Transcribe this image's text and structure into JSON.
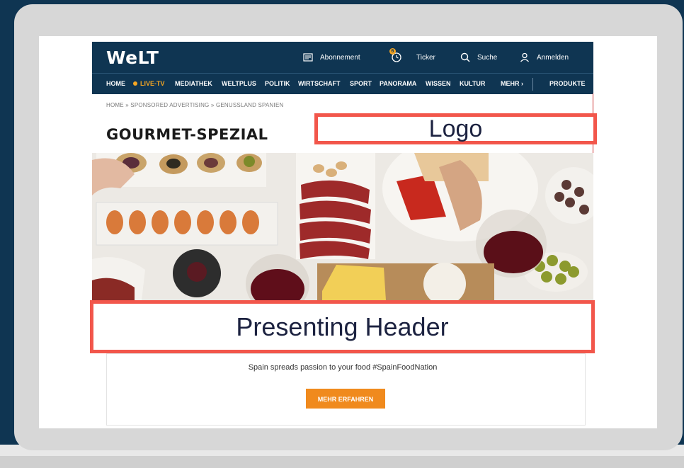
{
  "site": {
    "logo": "WeLT",
    "utility": {
      "abonnement": "Abonnement",
      "ticker": "Ticker",
      "ticker_badge": "6",
      "suche": "Suche",
      "anmelden": "Anmelden"
    },
    "nav": [
      "HOME",
      "LIVE-TV",
      "MEDIATHEK",
      "WELTPLUS",
      "POLITIK",
      "WIRTSCHAFT",
      "SPORT",
      "PANORAMA",
      "WISSEN",
      "KULTUR",
      "MEHR",
      "PRODUKTE"
    ],
    "breadcrumb": "HOME » SPONSORED ADVERTISING » GENUSSLAND SPANIEN",
    "page_title": "GOURMET-SPEZIAL",
    "tagline": "Spain spreads passion to your food #SpainFoodNation",
    "cta": "MEHR ERFAHREN"
  },
  "annotations": {
    "logo": "Logo",
    "header": "Presenting Header"
  },
  "colors": {
    "brand_navy": "#0f3552",
    "accent_orange": "#f08a1d",
    "live_orange": "#f5a623",
    "annotation_red": "#f2564b"
  }
}
